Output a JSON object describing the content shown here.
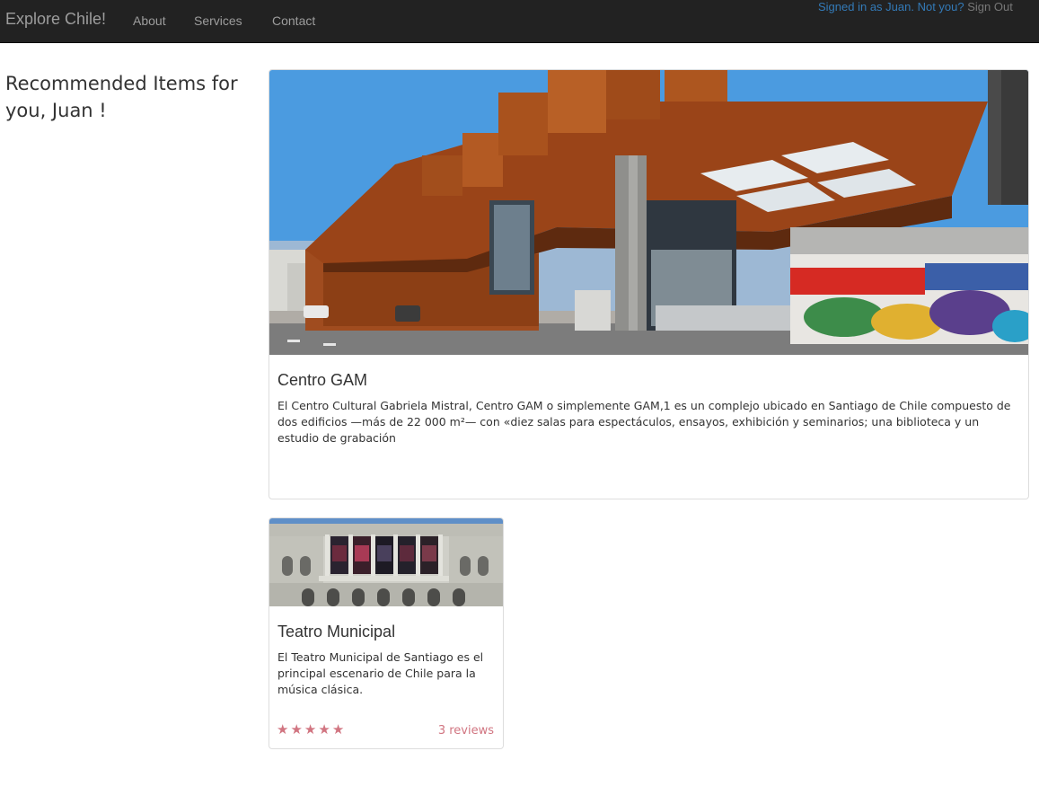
{
  "navbar": {
    "brand": "Explore Chile!",
    "links": [
      {
        "label": "About"
      },
      {
        "label": "Services"
      },
      {
        "label": "Contact"
      }
    ],
    "signed_in_text": "Signed in as Juan. Not you?",
    "sign_out_label": "Sign Out"
  },
  "sidebar": {
    "heading": "Recommended Items for you, Juan !"
  },
  "items": [
    {
      "title": "Centro GAM",
      "description": "El Centro Cultural Gabriela Mistral, Centro GAM o simplemente GAM,1 es un complejo ubicado en Santiago de Chile compuesto de dos edificios —más de 22 000 m²— con «diez salas para espectáculos, ensayos, exhibición y seminarios; una biblioteca y un estudio de grabación"
    },
    {
      "title": "Teatro Municipal",
      "description": "El Teatro Municipal de Santiago es el principal escenario de Chile para la música clásica.",
      "rating": 5,
      "rating_max": 5,
      "reviews_label": "3 reviews"
    }
  ],
  "colors": {
    "navbar_bg": "#222222",
    "link_blue": "#337ab7",
    "rating_color": "#d17581"
  }
}
